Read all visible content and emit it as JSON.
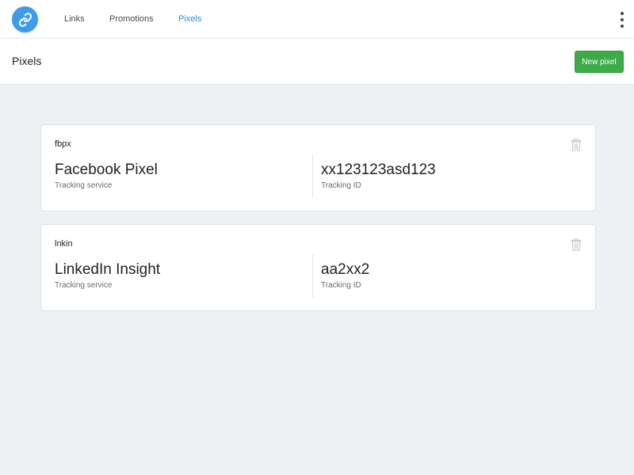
{
  "colors": {
    "accent": "#2f87d8",
    "logo": "#3d9cea",
    "primary_button": "#3eab49",
    "page_background": "#eef1f4"
  },
  "topbar": {
    "logo_icon": "link-icon",
    "nav": [
      {
        "label": "Links",
        "active": false
      },
      {
        "label": "Promotions",
        "active": false
      },
      {
        "label": "Pixels",
        "active": true
      }
    ],
    "menu_icon": "kebab-menu-icon"
  },
  "header": {
    "title": "Pixels",
    "new_button_label": "New pixel"
  },
  "pixels": [
    {
      "name": "fbpx",
      "service": "Facebook Pixel",
      "service_label": "Tracking service",
      "tracking_id": "xx123123asd123",
      "tracking_id_label": "Tracking ID",
      "delete_icon": "trash-icon"
    },
    {
      "name": "lnkin",
      "service": "LinkedIn Insight",
      "service_label": "Tracking service",
      "tracking_id": "aa2xx2",
      "tracking_id_label": "Tracking ID",
      "delete_icon": "trash-icon"
    }
  ]
}
